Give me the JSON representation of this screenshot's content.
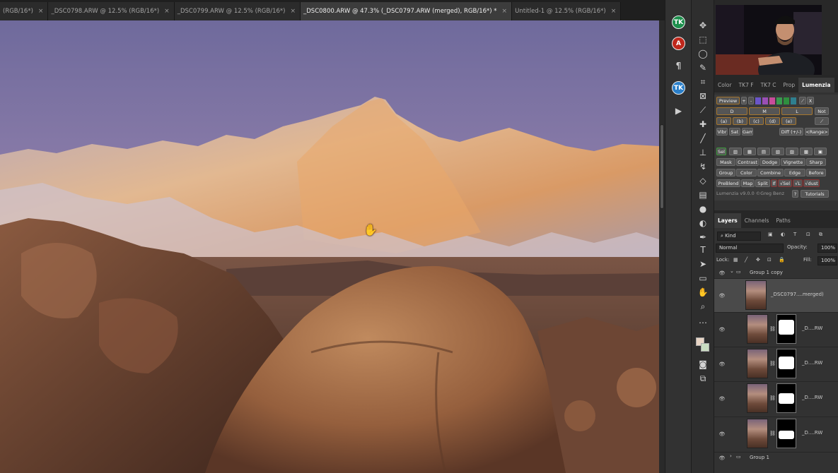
{
  "tabs": [
    {
      "label": "(RGB/16*)",
      "close": "×",
      "active": false
    },
    {
      "label": "_DSC0798.ARW @ 12.5% (RGB/16*)",
      "close": "×",
      "active": false
    },
    {
      "label": "_DSC0799.ARW @ 12.5% (RGB/16*)",
      "close": "×",
      "active": false
    },
    {
      "label": "_DSC0800.ARW @ 47.3% (_DSC0797.ARW (merged), RGB/16*) *",
      "close": "×",
      "active": true
    },
    {
      "label": "Untitled-1 @ 12.5% (RGB/16*)",
      "close": "×",
      "active": false
    }
  ],
  "panel_strip": [
    {
      "icon": "tk-icon",
      "label": "TK",
      "color": "#1d8f4c"
    },
    {
      "icon": "adobe-icon",
      "label": "A",
      "color": "#c0281c"
    },
    {
      "icon": "paragraph-icon",
      "label": "¶",
      "color": "transparent"
    },
    {
      "icon": "tk-color-icon",
      "label": "TK",
      "color": "#2a7fc9"
    },
    {
      "icon": "play-icon",
      "label": "▶",
      "color": "transparent"
    }
  ],
  "tools": [
    {
      "icon": "move-icon",
      "glyph": "✥"
    },
    {
      "icon": "marquee-icon",
      "glyph": "⬚"
    },
    {
      "icon": "lasso-icon",
      "glyph": "◯"
    },
    {
      "icon": "quick-select-icon",
      "glyph": "✎"
    },
    {
      "icon": "crop-icon",
      "glyph": "⌗"
    },
    {
      "icon": "frame-icon",
      "glyph": "⊠"
    },
    {
      "icon": "eyedropper-icon",
      "glyph": "⟋"
    },
    {
      "icon": "healing-icon",
      "glyph": "✚"
    },
    {
      "icon": "brush-icon",
      "glyph": "╱"
    },
    {
      "icon": "stamp-icon",
      "glyph": "⊥"
    },
    {
      "icon": "history-brush-icon",
      "glyph": "↯"
    },
    {
      "icon": "eraser-icon",
      "glyph": "◇"
    },
    {
      "icon": "gradient-icon",
      "glyph": "▤"
    },
    {
      "icon": "blur-icon",
      "glyph": "●"
    },
    {
      "icon": "dodge-icon",
      "glyph": "◐"
    },
    {
      "icon": "pen-icon",
      "glyph": "✒"
    },
    {
      "icon": "type-icon",
      "glyph": "T"
    },
    {
      "icon": "path-select-icon",
      "glyph": "➤"
    },
    {
      "icon": "shape-icon",
      "glyph": "▭"
    },
    {
      "icon": "hand-icon",
      "glyph": "✋"
    },
    {
      "icon": "zoom-icon",
      "glyph": "⌕"
    },
    {
      "icon": "more-icon",
      "glyph": "…"
    }
  ],
  "panel_tabs_top": [
    {
      "label": "Color",
      "active": false
    },
    {
      "label": "TK7 F",
      "active": false
    },
    {
      "label": "TK7 C",
      "active": false
    },
    {
      "label": "Prop",
      "active": false
    },
    {
      "label": "Lumenzia",
      "active": true
    }
  ],
  "lumenzia": {
    "preview": "Preview",
    "plus": "+",
    "minus": "-",
    "x": "X",
    "zones": [
      "D",
      "M",
      "L"
    ],
    "not": "Not",
    "letters": [
      "(a)",
      "(b)",
      "(c)",
      "(d)",
      "(e)"
    ],
    "vibe": [
      "Vibr",
      "Sat",
      "Gam"
    ],
    "diff": "Diff (+/-)",
    "range": "<Range>",
    "sel": "Sel",
    "row1": [
      "Mask",
      "Contrast",
      "Dodge",
      "Vignette",
      "Sharp"
    ],
    "row2": [
      "Group",
      "Color",
      "Combine",
      "Edge",
      "Before"
    ],
    "row3": [
      "PreBlend",
      "Map",
      "Split",
      "If",
      "√Sel",
      "√L",
      "√dust"
    ],
    "footer": "Lumenzia v9.0.0 ©Greg Benz",
    "help": "?",
    "tutorials": "Tutorials",
    "swatches": [
      "#6a55c9",
      "#9a4fb5",
      "#c84c9a",
      "#3a9a4f",
      "#2f8f3f",
      "#2f7f8f"
    ]
  },
  "layers_panel": {
    "tabs": [
      {
        "label": "Layers",
        "active": true
      },
      {
        "label": "Channels",
        "active": false
      },
      {
        "label": "Paths",
        "active": false
      }
    ],
    "kind": "Kind",
    "blend_mode": "Normal",
    "opacity_label": "Opacity:",
    "opacity_value": "100%",
    "lock_label": "Lock:",
    "fill_label": "Fill:",
    "fill_value": "100%",
    "group_copy": "Group 1 copy",
    "layers": [
      {
        "name": "_DSC0797....merged)",
        "has_mask": false
      },
      {
        "name": "_D....RW",
        "has_mask": true
      },
      {
        "name": "_D....RW",
        "has_mask": true
      },
      {
        "name": "_D....RW",
        "has_mask": true
      },
      {
        "name": "_D....RW",
        "has_mask": true
      }
    ],
    "group": "Group 1"
  }
}
